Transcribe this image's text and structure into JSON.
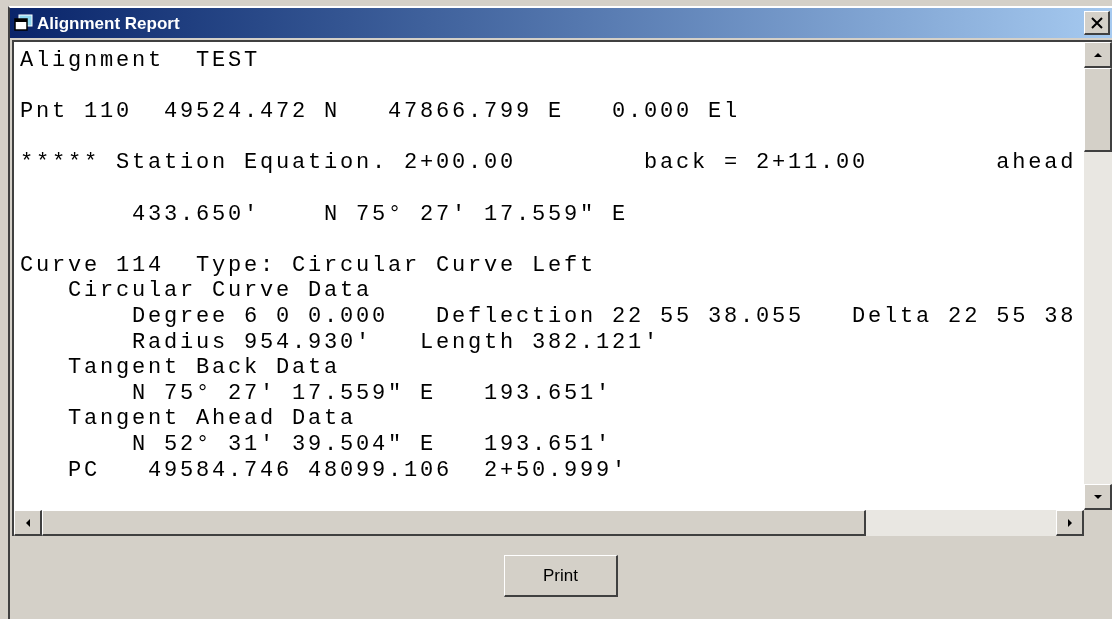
{
  "window": {
    "title": "Alignment Report"
  },
  "report": {
    "blocks": [
      [
        "Alignment  TEST"
      ],
      [
        "Pnt 110  49524.472 N   47866.799 E   0.000 El"
      ],
      [
        "***** Station Equation. 2+00.00        back = 2+11.00        ahead"
      ],
      [
        "       433.650'    N 75° 27' 17.559\" E"
      ],
      [
        "Curve 114  Type: Circular Curve Left",
        "   Circular Curve Data",
        "       Degree 6 0 0.000   Deflection 22 55 38.055   Delta 22 55 38",
        "       Radius 954.930'   Length 382.121'",
        "   Tangent Back Data",
        "       N 75° 27' 17.559\" E   193.651'",
        "   Tangent Ahead Data",
        "       N 52° 31' 39.504\" E   193.651'",
        "   PC   49584.746 48099.106  2+50.999'"
      ]
    ]
  },
  "buttons": [
    {
      "label": "Print"
    }
  ]
}
